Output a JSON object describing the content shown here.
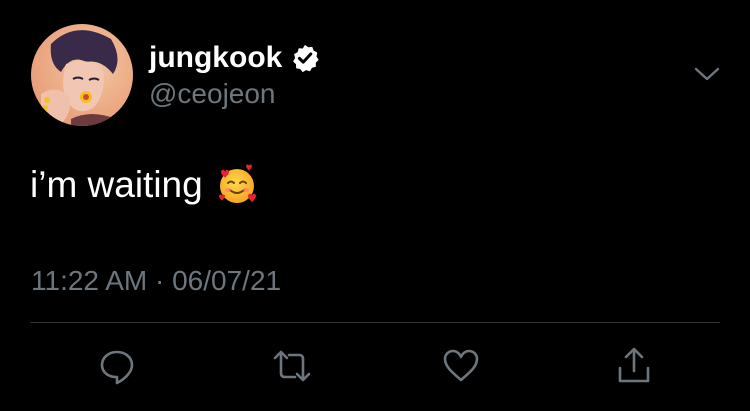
{
  "user": {
    "display_name": "jungkook",
    "handle": "@ceojeon",
    "verified": true,
    "avatar_icon": "profile-photo"
  },
  "tweet": {
    "text": "i’m waiting",
    "emoji": "smiling-face-with-hearts",
    "emoji_char": "🥰",
    "timestamp": "11:22 AM · 06/07/21"
  },
  "actions": [
    {
      "name": "reply",
      "icon": "speech-bubble-icon"
    },
    {
      "name": "retweet",
      "icon": "retweet-icon"
    },
    {
      "name": "like",
      "icon": "heart-icon"
    },
    {
      "name": "share",
      "icon": "share-icon"
    }
  ],
  "colors": {
    "background": "#000000",
    "text": "#ffffff",
    "secondary": "#6e767d",
    "divider": "#2f3336",
    "verified_badge": "#ffffff"
  }
}
